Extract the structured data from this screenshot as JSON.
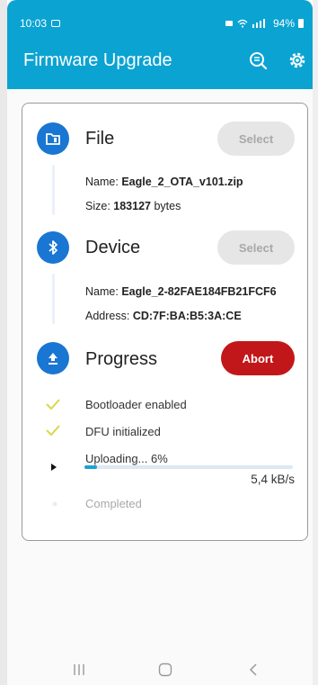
{
  "status": {
    "time": "10:03",
    "battery": "94%"
  },
  "appbar": {
    "title": "Firmware Upgrade",
    "icons": [
      "search-icon",
      "gear-icon"
    ]
  },
  "file": {
    "title": "File",
    "select_label": "Select",
    "name_label": "Name:",
    "name_value": "Eagle_2_OTA_v101.zip",
    "size_label": "Size:",
    "size_value": "183127",
    "size_unit": "bytes"
  },
  "device": {
    "title": "Device",
    "select_label": "Select",
    "name_label": "Name:",
    "name_value": "Eagle_2-82FAE184FB21FCF6",
    "address_label": "Address:",
    "address_value": "CD:7F:BA:B5:3A:CE"
  },
  "progress": {
    "title": "Progress",
    "abort_label": "Abort",
    "steps": [
      {
        "label": "Bootloader enabled"
      },
      {
        "label": "DFU initialized"
      },
      {
        "label": "Uploading... 6%"
      },
      {
        "label": "Completed"
      }
    ],
    "upload_fraction": 0.06,
    "speed": "5,4 kB/s"
  },
  "colors": {
    "appbar": "#0ba3d2",
    "step_icon": "#1976d2",
    "abort": "#c2171a",
    "check": "#d8d84a",
    "progress": "#1ba2d6"
  }
}
